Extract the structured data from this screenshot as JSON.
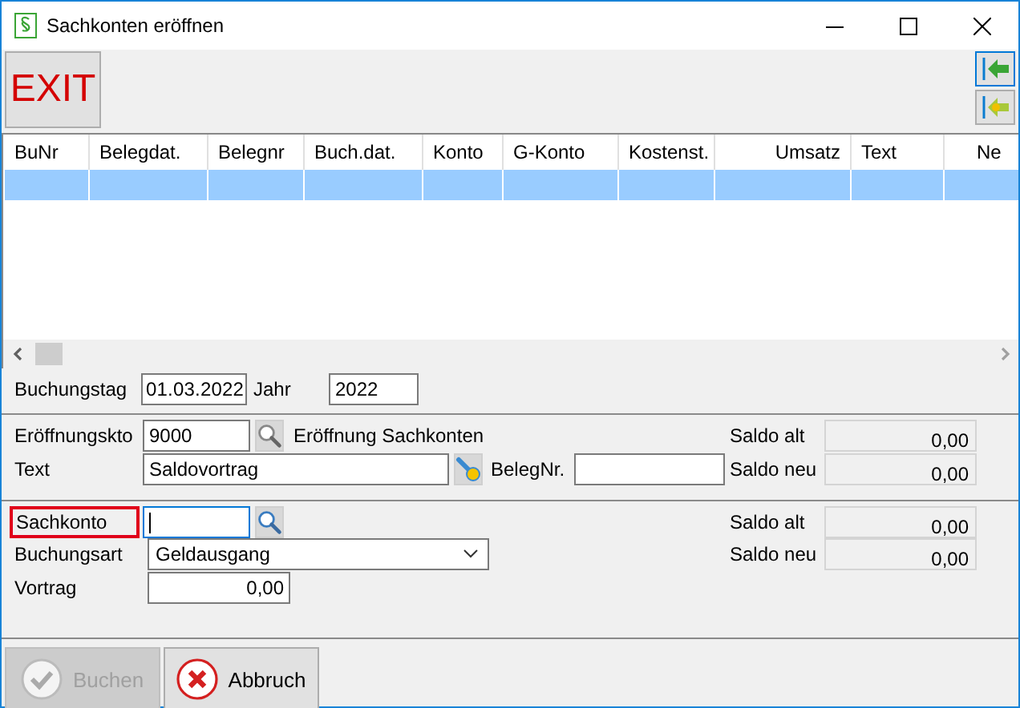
{
  "window": {
    "title": "Sachkonten eröffnen"
  },
  "toolbar": {
    "exit_label": "EXIT"
  },
  "table": {
    "columns": [
      {
        "label": "BuNr"
      },
      {
        "label": "Belegdat."
      },
      {
        "label": "Belegnr"
      },
      {
        "label": "Buch.dat."
      },
      {
        "label": "Konto"
      },
      {
        "label": "G-Konto"
      },
      {
        "label": "Kostenst."
      },
      {
        "label": "Umsatz"
      },
      {
        "label": "Text"
      },
      {
        "label": "Ne"
      }
    ],
    "rows": [
      {
        "selected": true
      }
    ]
  },
  "booking": {
    "date_label": "Buchungstag",
    "date_value": "01.03.2022",
    "year_label": "Jahr",
    "year_value": "2022"
  },
  "opening": {
    "account_label": "Eröffnungskto",
    "account_value": "9000",
    "account_name": "Eröffnung Sachkonten",
    "text_label": "Text",
    "text_value": "Saldovortrag",
    "receipt_label": "BelegNr.",
    "balances": [
      {
        "label": "Saldo alt",
        "value": "0,00"
      },
      {
        "label": "Saldo neu",
        "value": "0,00"
      }
    ]
  },
  "account": {
    "account_label": "Sachkonto",
    "account_focused": true,
    "type_label": "Buchungsart",
    "type_value": "Geldausgang",
    "carry_label": "Vortrag",
    "carry_value": "0,00",
    "balances": [
      {
        "label": "Saldo alt",
        "value": "0,00"
      },
      {
        "label": "Saldo neu",
        "value": "0,00"
      }
    ]
  },
  "buttons": [
    {
      "kind": "ok",
      "label": "Buchen",
      "disabled": true
    },
    {
      "kind": "cancel",
      "label": "Abbruch",
      "disabled": false
    }
  ]
}
